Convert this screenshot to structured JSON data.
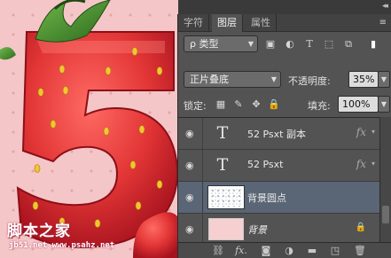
{
  "canvas": {
    "watermark": "脚本之家",
    "watermark_url": "jb51.net  www.psahz.net",
    "colors": {
      "background": "#f4c6c8",
      "dots": "#e6a3a8",
      "strawberry": "#e53a3b",
      "leaf": "#3f8a2a"
    }
  },
  "panel": {
    "tabs": [
      {
        "label": "字符",
        "active": false
      },
      {
        "label": "图层",
        "active": true
      },
      {
        "label": "属性",
        "active": false
      }
    ],
    "filter": {
      "kind_label": "ρ 类型",
      "icons": [
        "image-filter-icon",
        "adjustment-filter-icon",
        "type-filter-icon",
        "shape-filter-icon",
        "smart-object-filter-icon",
        "toggle-filter-icon"
      ]
    },
    "blend": {
      "mode": "正片叠底",
      "opacity_label": "不透明度:",
      "opacity_value": "35%"
    },
    "lock": {
      "label": "锁定:",
      "fill_label": "填充:",
      "fill_value": "100%"
    },
    "layers": [
      {
        "name": "52 Psxt 副本",
        "type": "text",
        "fx": "fx",
        "selected": false,
        "italic": false,
        "locked": false
      },
      {
        "name": "52 Psxt",
        "type": "text",
        "fx": "fx",
        "selected": false,
        "italic": false,
        "locked": false
      },
      {
        "name": "背景圆点",
        "type": "pixel",
        "fx": "",
        "selected": true,
        "italic": false,
        "locked": false
      },
      {
        "name": "背景",
        "type": "background",
        "fx": "",
        "selected": false,
        "italic": true,
        "locked": true
      }
    ],
    "thumb_glyph": "T",
    "eye_glyph": "◉",
    "bottom_icons": [
      "link-layers-icon",
      "fx-icon",
      "mask-icon",
      "adjustment-layer-icon",
      "group-folder-icon",
      "new-layer-icon",
      "trash-icon"
    ],
    "bottom_fx_label": "fx."
  }
}
